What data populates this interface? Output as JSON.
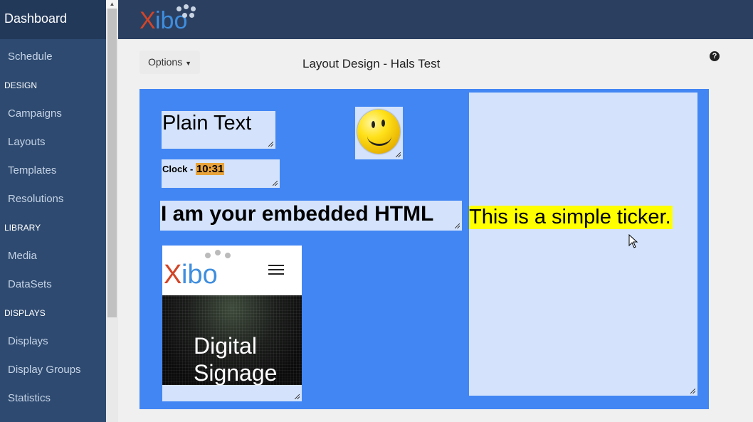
{
  "sidebar": {
    "title": "Dashboard",
    "items": [
      {
        "type": "item",
        "label": "Schedule"
      },
      {
        "type": "section",
        "label": "DESIGN"
      },
      {
        "type": "item",
        "label": "Campaigns"
      },
      {
        "type": "item",
        "label": "Layouts"
      },
      {
        "type": "item",
        "label": "Templates"
      },
      {
        "type": "item",
        "label": "Resolutions"
      },
      {
        "type": "section",
        "label": "LIBRARY"
      },
      {
        "type": "item",
        "label": "Media"
      },
      {
        "type": "item",
        "label": "DataSets"
      },
      {
        "type": "section",
        "label": "DISPLAYS"
      },
      {
        "type": "item",
        "label": "Displays"
      },
      {
        "type": "item",
        "label": "Display Groups"
      },
      {
        "type": "item",
        "label": "Statistics"
      }
    ]
  },
  "header": {
    "logo_x": "X",
    "logo_rest": "ibo"
  },
  "toolbar": {
    "options_label": "Options",
    "page_title": "Layout Design - Hals Test",
    "help": "?"
  },
  "layout": {
    "plain_text": "Plain Text",
    "clock_label": "Clock - ",
    "clock_time": "10:31",
    "embedded_html": "I am your embedded HTML",
    "ticker": "This is a simple ticker.",
    "webpage_logo_x": "X",
    "webpage_logo_rest": "ibo",
    "webpage_title_line1": "Digital",
    "webpage_title_line2": "Signage"
  },
  "colors": {
    "sidebar": "#2e4a70",
    "topbar": "#2b3f61",
    "canvas": "#4286f4",
    "region": "#d4e3fb",
    "ticker_highlight": "#ffff00",
    "clock_highlight": "#e8a33a"
  },
  "icons": [
    "help-icon",
    "caret-down-icon",
    "resize-grip-icon",
    "hamburger-menu-icon",
    "mouse-cursor-icon",
    "smiley-image"
  ]
}
